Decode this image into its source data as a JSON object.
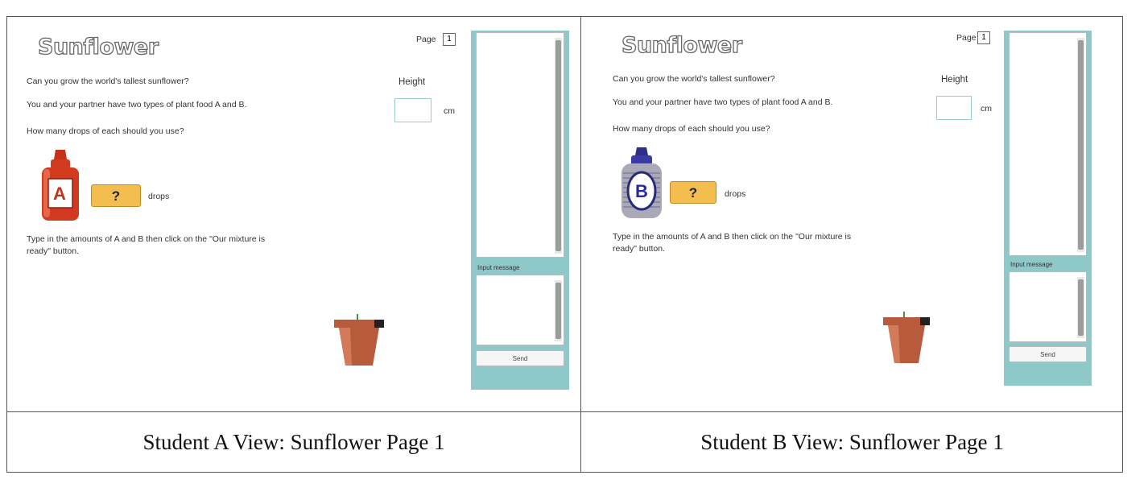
{
  "views": {
    "a": {
      "app_title": "Sunflower",
      "page_label": "Page",
      "page_number": "1",
      "question": "Can you grow the world's tallest sunflower?",
      "intro": "You and your partner have two types of plant food A and B.",
      "prompt": "How many drops of each should you use?",
      "height_label": "Height",
      "height_unit": "cm",
      "bottle_letter": "A",
      "drops_button": "?",
      "drops_label": "drops",
      "instruction": "Type in the amounts of A and B then click on the \"Our mixture is ready\" button.",
      "input_message_label": "Input message",
      "send_label": "Send",
      "bottle_color": "#d13a1e"
    },
    "b": {
      "app_title": "Sunflower",
      "page_label": "Page",
      "page_number": "1",
      "question": "Can you grow the world's tallest sunflower?",
      "intro": "You and your partner have two types of plant food A and B.",
      "prompt": "How many drops of each should you use?",
      "height_label": "Height",
      "height_unit": "cm",
      "bottle_letter": "B",
      "drops_button": "?",
      "drops_label": "drops",
      "instruction": "Type in the amounts of A and B then click on the \"Our mixture is ready\" button.",
      "input_message_label": "Input message",
      "send_label": "Send",
      "bottle_color": "#3a3aa0"
    }
  },
  "captions": {
    "a": "Student A View: Sunflower Page 1",
    "b": "Student B View: Sunflower Page 1"
  },
  "colors": {
    "chat_panel": "#8ec9c9",
    "drops_button": "#f3bd50",
    "pot": "#b85a3c"
  }
}
